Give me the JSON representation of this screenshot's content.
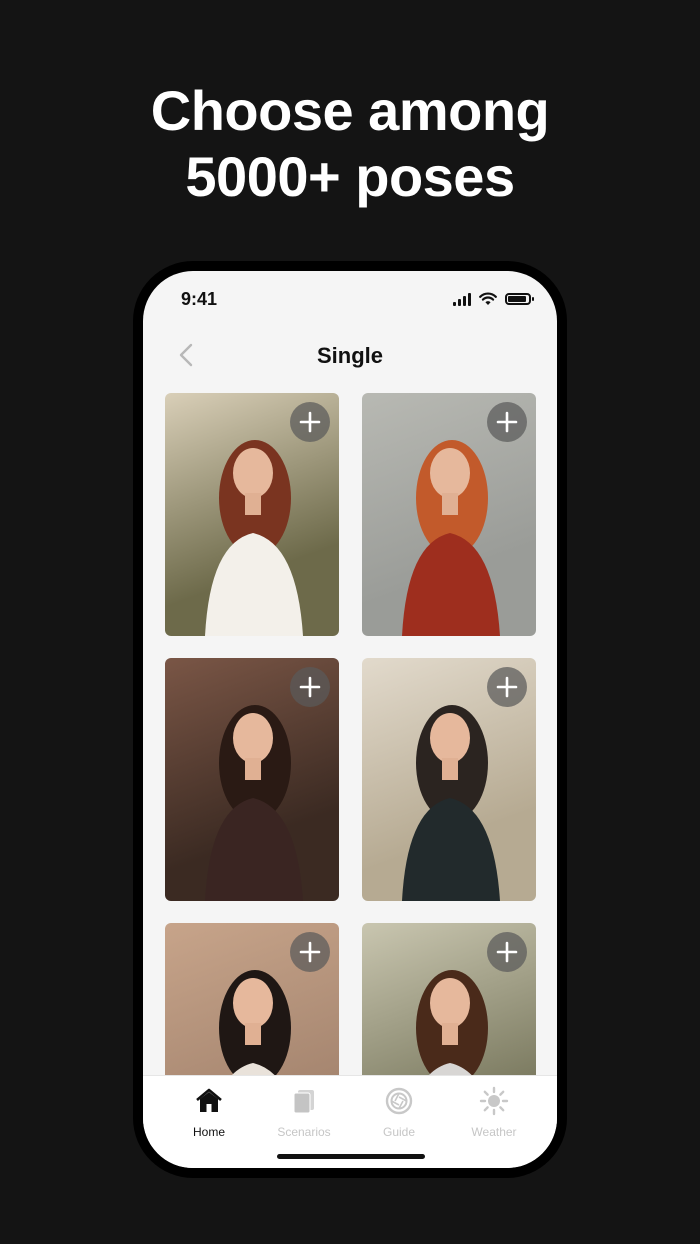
{
  "headline": {
    "line1": "Choose among",
    "line2": "5000+ poses"
  },
  "status_bar": {
    "time": "9:41",
    "battery_level": 0.9
  },
  "nav": {
    "title": "Single",
    "back_icon": "chevron-left-icon"
  },
  "poses": [
    {
      "add_icon": "plus-icon",
      "bg": "#6d6a4a",
      "bg2": "#d9cfb8",
      "hair": "#7a3420",
      "top": "#f3f0ea"
    },
    {
      "add_icon": "plus-icon",
      "bg": "#9a9c98",
      "bg2": "#b8b9b3",
      "hair": "#c25a2b",
      "top": "#9e2e1e"
    },
    {
      "add_icon": "plus-icon",
      "bg": "#3b2a22",
      "bg2": "#7a5646",
      "hair": "#2a1a14",
      "top": "#3a2522"
    },
    {
      "add_icon": "plus-icon",
      "bg": "#b6aa92",
      "bg2": "#e2dacc",
      "hair": "#2b2420",
      "top": "#222a2c"
    },
    {
      "add_icon": "plus-icon",
      "bg": "#a68670",
      "bg2": "#c7a48a",
      "hair": "#1f1714",
      "top": "#e9e2da"
    },
    {
      "add_icon": "plus-icon",
      "bg": "#7d7c62",
      "bg2": "#c9c6b0",
      "hair": "#4a2a1a",
      "top": "#d8d6d4"
    }
  ],
  "tabs": [
    {
      "label": "Home",
      "icon": "house-icon",
      "active": true
    },
    {
      "label": "Scenarios",
      "icon": "cards-icon",
      "active": false
    },
    {
      "label": "Guide",
      "icon": "aperture-icon",
      "active": false
    },
    {
      "label": "Weather",
      "icon": "sun-icon",
      "active": false
    }
  ]
}
